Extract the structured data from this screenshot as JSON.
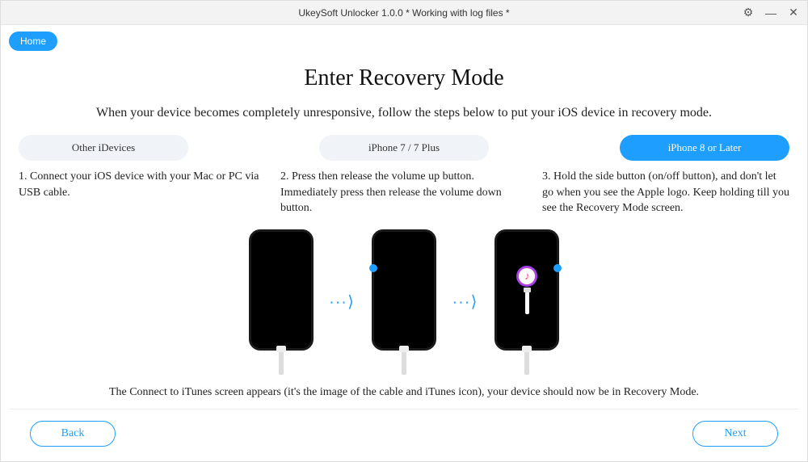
{
  "titlebar": {
    "title": "UkeySoft Unlocker 1.0.0 * Working with log files *"
  },
  "home_label": "Home",
  "page_title": "Enter Recovery Mode",
  "subtitle": "When your device becomes completely unresponsive, follow the steps below to put your iOS device in recovery mode.",
  "tabs": {
    "other": "Other iDevices",
    "iphone7": "iPhone 7 / 7 Plus",
    "iphone8": "iPhone 8 or Later"
  },
  "steps": {
    "s1": "1. Connect your iOS device with your Mac or PC via USB cable.",
    "s2": "2. Press then release the volume up button. Immediately press then release the volume down button.",
    "s3": "3. Hold the side button (on/off button), and don't let go when you see the Apple logo. Keep holding till you see the Recovery Mode screen."
  },
  "footer_text": "The Connect to iTunes screen appears (it's the image of the cable and iTunes icon), your device should now be in Recovery Mode.",
  "nav": {
    "back": "Back",
    "next": "Next"
  },
  "icons": {
    "settings": "⚙",
    "minimize": "—",
    "close": "✕",
    "arrow": "∙∙∙⟩",
    "note": "♪"
  }
}
